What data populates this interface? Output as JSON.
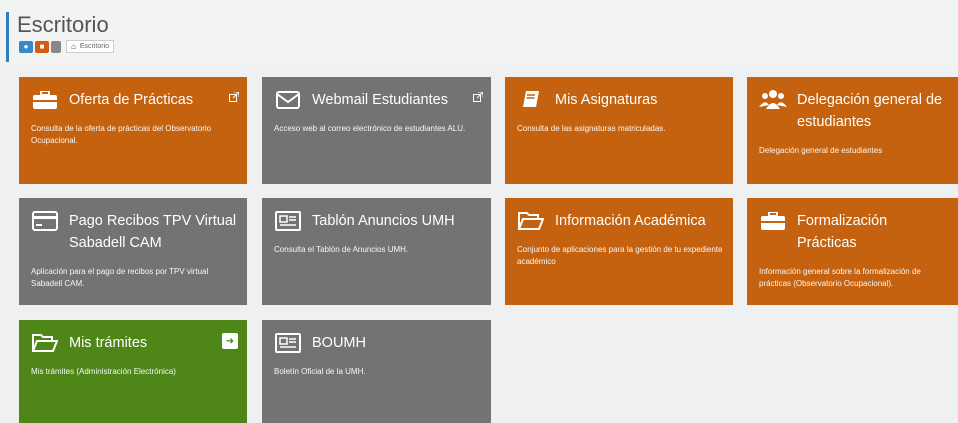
{
  "header": {
    "title": "Escritorio",
    "breadcrumb": {
      "current": "Escritorio"
    }
  },
  "colors": {
    "orange": "#c5620f",
    "gray": "#737373",
    "green": "#4e8618",
    "accent": "#2f7fbf"
  },
  "tiles": [
    {
      "title": "Oferta de Prácticas",
      "desc": "Consulta de la oferta de prácticas del Observatorio Ocupacional.",
      "icon": "briefcase-icon",
      "external": true
    },
    {
      "title": "Webmail Estudiantes",
      "desc": "Acceso web al correo electrónico de estudiantes ALU.",
      "icon": "envelope-icon",
      "external": true
    },
    {
      "title": "Mis Asignaturas",
      "desc": "Consulta de las asignaturas matriculadas.",
      "icon": "book-icon"
    },
    {
      "title": "Delegación general de estudiantes",
      "desc": "Delegación general de estudiantes",
      "icon": "group-icon"
    },
    {
      "title": "Pago Recibos TPV Virtual Sabadell CAM",
      "desc": "Aplicación para el pago de recibos por TPV virtual Sabadell CAM.",
      "icon": "credit-card-icon"
    },
    {
      "title": "Tablón Anuncios UMH",
      "desc": "Consulta el Tablón de Anuncios UMH.",
      "icon": "newspaper-icon"
    },
    {
      "title": "Información Académica",
      "desc": "Conjunto de aplicaciones para la gestión de tu expediente académico",
      "icon": "folder-open-icon"
    },
    {
      "title": "Formalización Prácticas",
      "desc": "Información general sobre la formalización de prácticas (Observatorio Ocupacional).",
      "icon": "briefcase-icon"
    },
    {
      "title": "Mis trámites",
      "desc": "Mis trámites (Administración Electrónica)",
      "icon": "folder-open-icon",
      "badge": "sign-in-icon"
    },
    {
      "title": "BOUMH",
      "desc": "Boletín Oficial de la UMH.",
      "icon": "newspaper-icon"
    }
  ]
}
